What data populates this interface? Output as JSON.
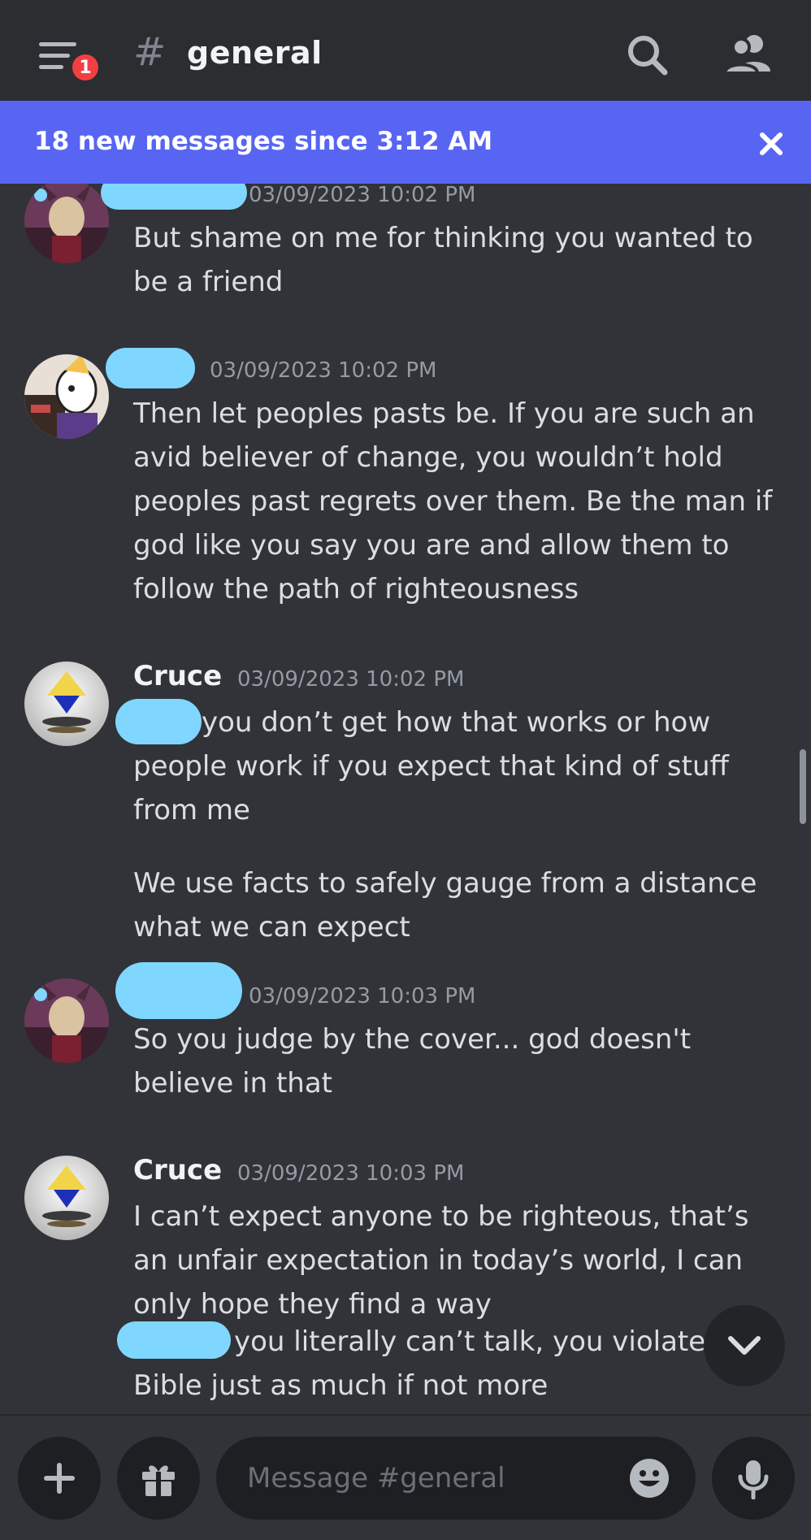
{
  "header": {
    "menu_icon": "hamburger-icon",
    "badge_count": "1",
    "hash_symbol": "#",
    "channel_name": "general",
    "search_icon": "search-icon",
    "members_icon": "members-icon"
  },
  "banner": {
    "text": "18 new messages since 3:12 AM",
    "close_icon": "close-icon",
    "color": "#5865f2"
  },
  "messages": [
    {
      "author": "",
      "timestamp": "03/09/2023 10:02 PM",
      "lines": [
        "But shame on me for thinking you wanted to",
        "be a friend"
      ]
    },
    {
      "author": "",
      "timestamp": "03/09/2023 10:02 PM",
      "lines": [
        "Then let peoples pasts be. If you are such an",
        "avid believer of change, you wouldn’t hold",
        "peoples past regrets over them. Be the man if",
        "god like you say you are and allow them to",
        "follow the path of righteousness"
      ]
    },
    {
      "author": "Cruce",
      "timestamp": "03/09/2023 10:02 PM",
      "lines_a": [
        "you don’t get how that works or how",
        "people work if you expect that kind of stuff",
        "from me"
      ],
      "lines_b": [
        "We use facts to safely gauge from a distance",
        "what we can expect"
      ]
    },
    {
      "author": "",
      "timestamp": "03/09/2023 10:03 PM",
      "lines": [
        "So you judge by the cover... god doesn't",
        "believe in that"
      ]
    },
    {
      "author": "Cruce",
      "timestamp": "03/09/2023 10:03 PM",
      "lines_a": [
        "I can’t expect anyone to be righteous, that’s",
        "an unfair expectation in today’s world, I can",
        "only hope they find a way"
      ],
      "lines_b": [
        "you literally can’t talk, you violate",
        "Bible just as much if not more"
      ]
    }
  ],
  "composer": {
    "add_icon": "plus-icon",
    "gift_icon": "gift-icon",
    "placeholder": "Message #general",
    "emoji_icon": "emoji-icon",
    "mic_icon": "microphone-icon"
  },
  "jump_icon": "chevron-down-icon",
  "colors": {
    "background": "#313338",
    "header": "#2b2d31",
    "accent": "#5865f2",
    "badge": "#f23f43",
    "redaction": "#7fd6ff"
  }
}
